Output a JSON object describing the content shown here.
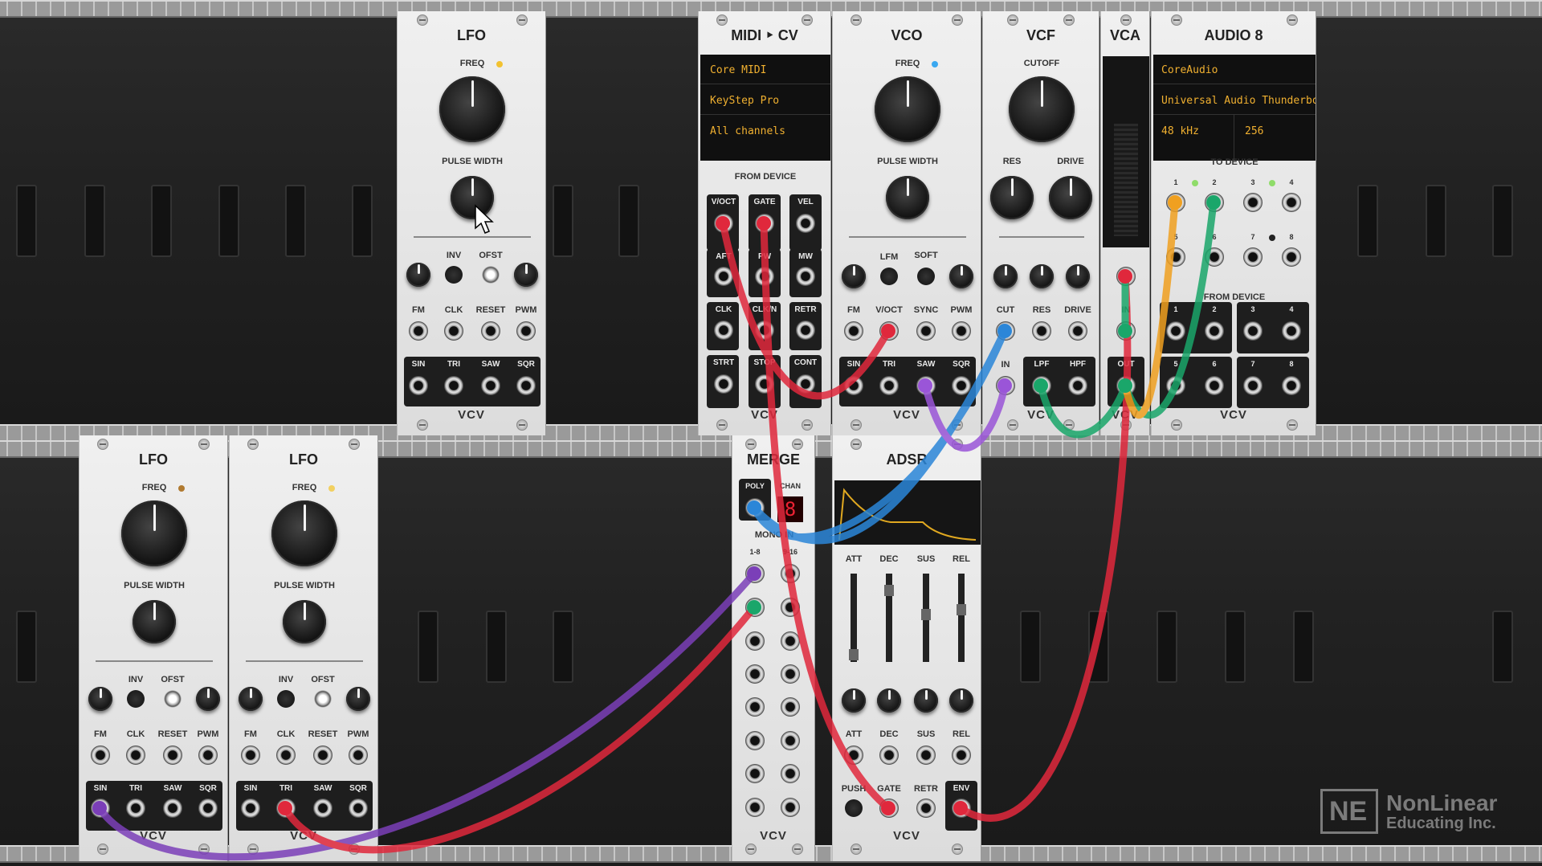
{
  "modules": {
    "lfo_top": {
      "title": "LFO",
      "freq": "FREQ",
      "pw": "PULSE WIDTH",
      "inv": "INV",
      "ofst": "OFST",
      "fm": "FM",
      "clk": "CLK",
      "reset": "RESET",
      "pwm": "PWM",
      "sin": "SIN",
      "tri": "TRI",
      "saw": "SAW",
      "sqr": "SQR",
      "brand": "VCV"
    },
    "lfo_b1": {
      "title": "LFO",
      "freq": "FREQ",
      "pw": "PULSE WIDTH",
      "inv": "INV",
      "ofst": "OFST",
      "fm": "FM",
      "clk": "CLK",
      "reset": "RESET",
      "pwm": "PWM",
      "sin": "SIN",
      "tri": "TRI",
      "saw": "SAW",
      "sqr": "SQR",
      "brand": "VCV"
    },
    "lfo_b2": {
      "title": "LFO",
      "freq": "FREQ",
      "pw": "PULSE WIDTH",
      "inv": "INV",
      "ofst": "OFST",
      "fm": "FM",
      "clk": "CLK",
      "reset": "RESET",
      "pwm": "PWM",
      "sin": "SIN",
      "tri": "TRI",
      "saw": "SAW",
      "sqr": "SQR",
      "brand": "VCV"
    },
    "midi_cv": {
      "title": "MIDI ‣ CV",
      "driver": "Core MIDI",
      "device": "KeyStep Pro",
      "channel": "All channels",
      "from_device": "FROM DEVICE",
      "jacks": [
        "V/OCT",
        "GATE",
        "VEL",
        "AFT",
        "PW",
        "MW",
        "CLK",
        "CLK/N",
        "RETR",
        "STRT",
        "STOP",
        "CONT"
      ],
      "brand": "VCV"
    },
    "vco": {
      "title": "VCO",
      "freq": "FREQ",
      "pw": "PULSE WIDTH",
      "lfm": "LFM",
      "soft": "SOFT",
      "fm": "FM",
      "voct": "V/OCT",
      "sync": "SYNC",
      "pwm": "PWM",
      "sin": "SIN",
      "tri": "TRI",
      "saw": "SAW",
      "sqr": "SQR",
      "brand": "VCV"
    },
    "vcf": {
      "title": "VCF",
      "cutoff": "CUTOFF",
      "res": "RES",
      "drive": "DRIVE",
      "cut": "CUT",
      "res_in": "RES",
      "drive_in": "DRIVE",
      "in": "IN",
      "lpf": "LPF",
      "hpf": "HPF",
      "brand": "VCV"
    },
    "vca": {
      "title": "VCA",
      "in": "IN",
      "out": "OUT",
      "brand": "VCV"
    },
    "audio8": {
      "title": "AUDIO 8",
      "driver": "CoreAudio",
      "device": "Universal Audio Thunderbo",
      "rate": "48 kHz",
      "block": "256",
      "to_device": "TO DEVICE",
      "from_device": "FROM DEVICE",
      "nums": [
        "1",
        "2",
        "3",
        "4",
        "5",
        "6",
        "7",
        "8"
      ],
      "brand": "VCV"
    },
    "merge": {
      "title": "MERGE",
      "poly": "POLY",
      "chan": "CHAN",
      "chan_value": "8",
      "mono_in": "MONO IN",
      "r1": "1-8",
      "r2": "9-16",
      "brand": "VCV"
    },
    "adsr": {
      "title": "ADSR",
      "att": "ATT",
      "dec": "DEC",
      "sus": "SUS",
      "rel": "REL",
      "push": "PUSH",
      "gate": "GATE",
      "retr": "RETR",
      "env": "ENV",
      "brand": "VCV"
    }
  },
  "watermark": {
    "mark": "NE",
    "line1": "NonLinear",
    "line2": "Educating Inc."
  },
  "colors": {
    "cable_red": "#e0283c",
    "cable_purple": "#7b3fb8",
    "cable_green": "#1aa66a",
    "cable_blue": "#2b86d8",
    "cable_orange": "#f0a020",
    "cable_violet": "#9a55d8"
  }
}
